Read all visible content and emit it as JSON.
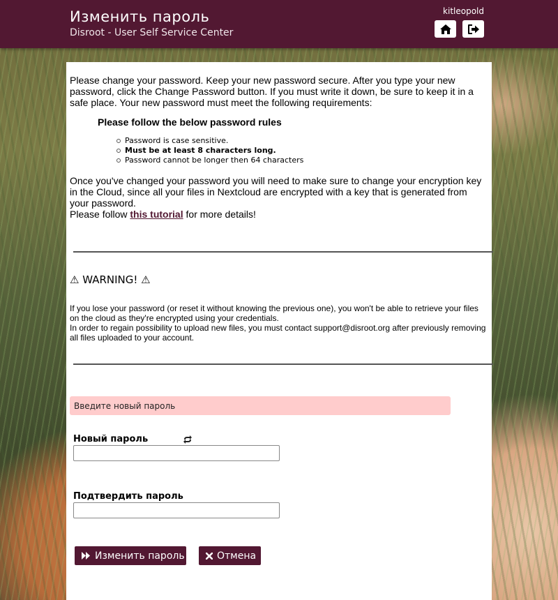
{
  "header": {
    "title": "Изменить пароль",
    "subtitle": "Disroot - User Self Service Center",
    "username": "kitleopold",
    "home_icon": "home-icon",
    "logout_icon": "sign-out-icon",
    "bar_color": "#521832"
  },
  "content": {
    "intro": "Please change your password. Keep your new password secure. After you type your new password, click the Change Password button. If you must write it down, be sure to keep it in a safe place. Your new password must meet the following requirements:",
    "rules_title": "Please follow the below password rules",
    "rules": [
      "Password is case sensitive.",
      "Must be at least 8 characters long.",
      "Password cannot be longer then 64 characters"
    ],
    "cloud_note": "Once you've changed your password you will need to make sure to change your encryption key in the Cloud, since all your files in Nextcloud are encrypted with a key that is generated from your password.",
    "follow_prefix": "Please follow ",
    "tutorial_link": "this tutorial",
    "follow_suffix": " for more details!",
    "warning_title": "⚠ WARNING! ⚠",
    "warning_line1": "If you lose your password (or reset it without knowing the previous one), you won't be able to retrieve your files on the cloud as they're encrypted using your credentials.",
    "warning_line2": "In order to regain possibility to upload new files, you must contact support@disroot.org after previously removing all files uploaded to your account."
  },
  "form": {
    "alert": "Введите новый пароль",
    "new_password_label": "Новый пароль",
    "new_password_value": "",
    "confirm_password_label": "Подтвердить пароль",
    "confirm_password_value": "",
    "change_button": "Изменить пароль",
    "cancel_button": "Отмена"
  }
}
